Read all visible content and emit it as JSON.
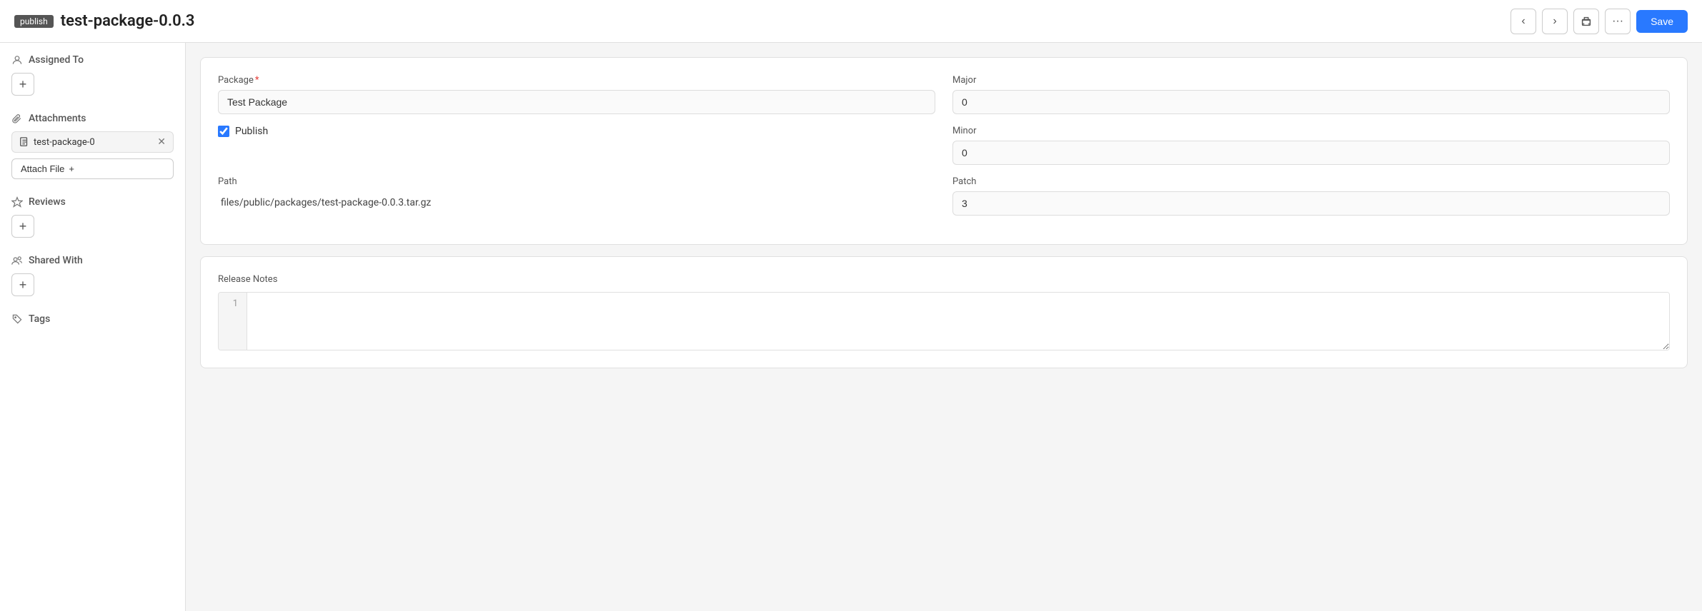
{
  "publish_badge": "publish",
  "page_title": "test-package-0.0.3",
  "header": {
    "save_label": "Save",
    "prev_icon": "‹",
    "next_icon": "›",
    "print_icon": "🖨",
    "more_icon": "···"
  },
  "sidebar": {
    "assigned_to_label": "Assigned To",
    "attachments_label": "Attachments",
    "attachment_filename": "test-package-0",
    "attach_file_label": "Attach File",
    "reviews_label": "Reviews",
    "shared_with_label": "Shared With",
    "tags_label": "Tags"
  },
  "form": {
    "package_label": "Package",
    "package_value": "Test Package",
    "publish_label": "Publish",
    "publish_checked": true,
    "path_label": "Path",
    "path_value": "files/public/packages/test-package-0.0.3.tar.gz",
    "major_label": "Major",
    "major_value": "0",
    "minor_label": "Minor",
    "minor_value": "0",
    "patch_label": "Patch",
    "patch_value": "3"
  },
  "release_notes": {
    "label": "Release Notes",
    "line_number": "1"
  }
}
